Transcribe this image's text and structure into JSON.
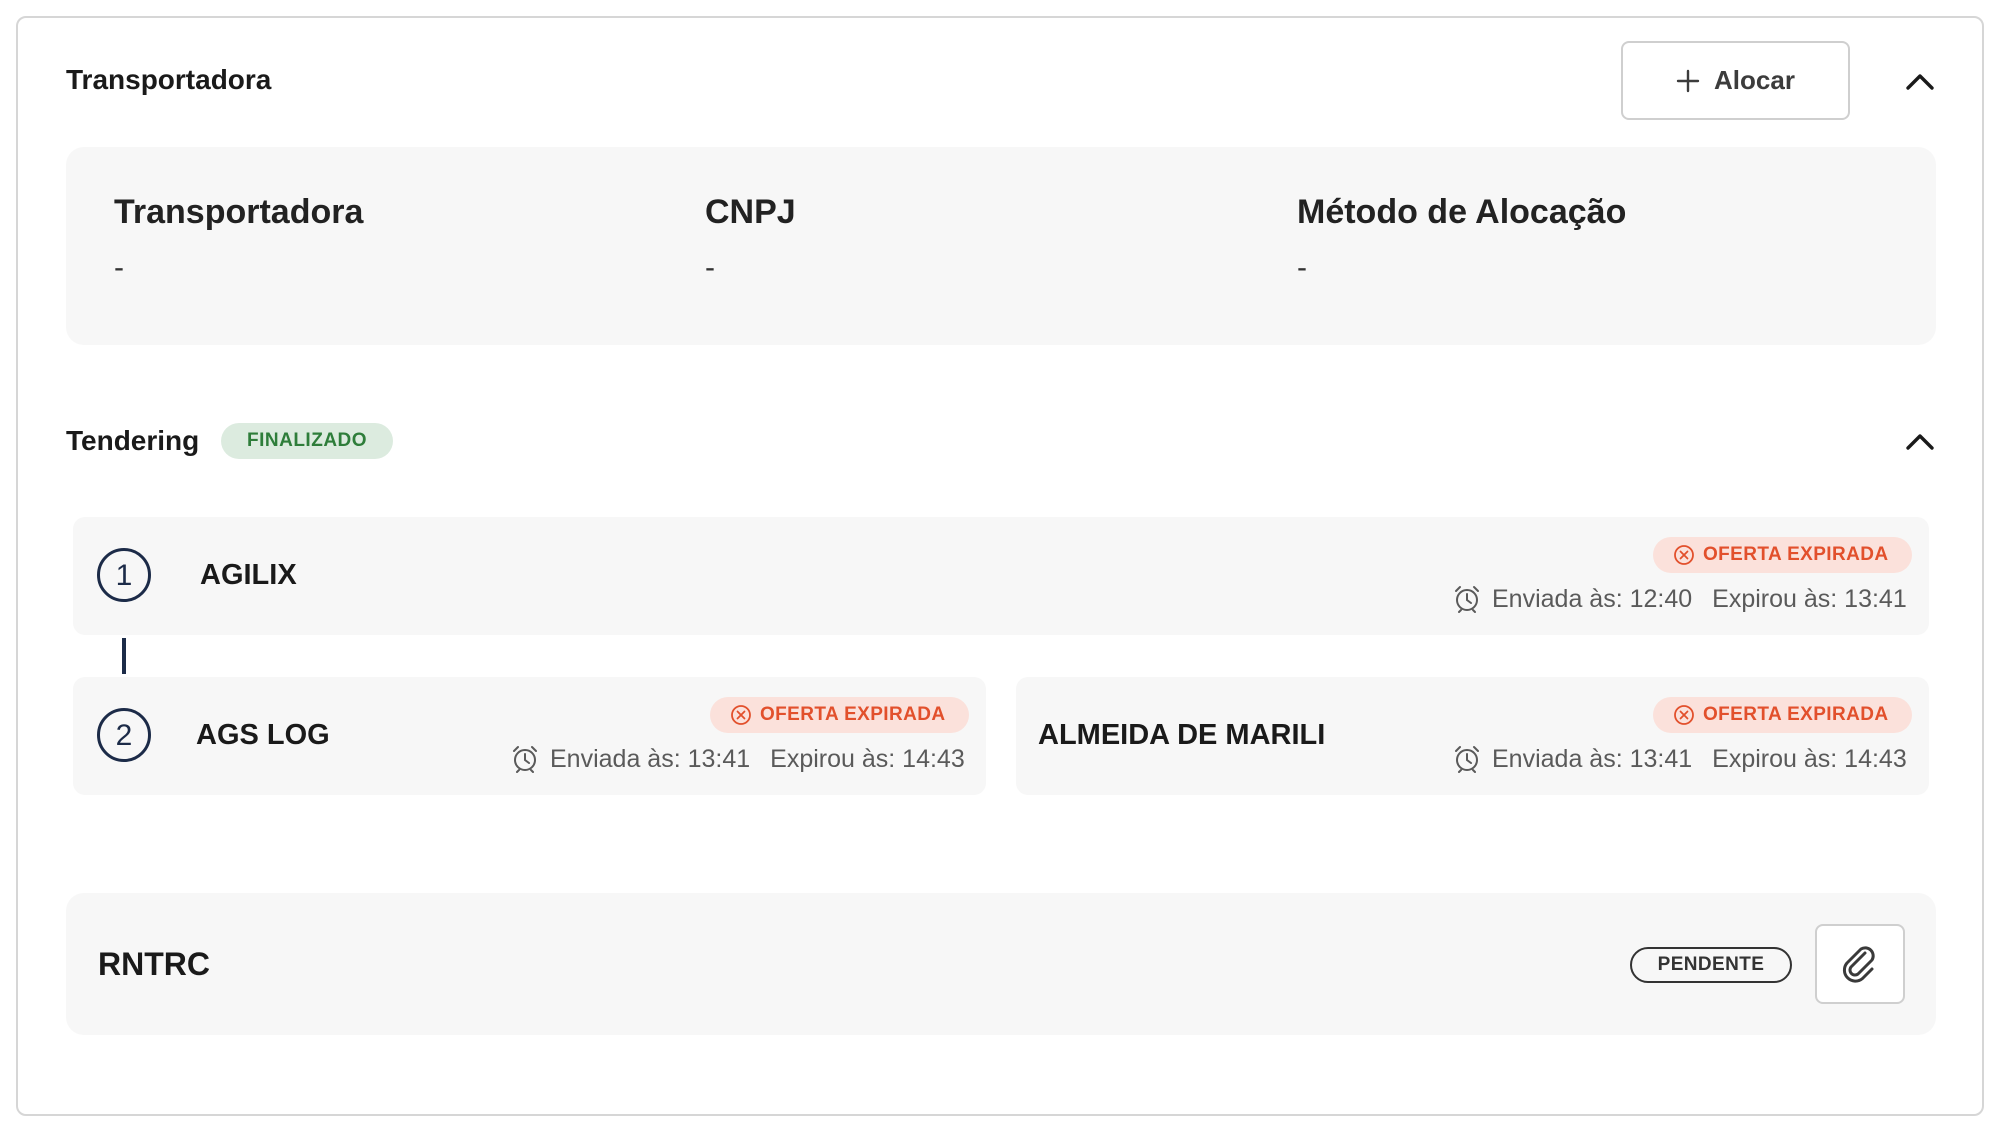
{
  "carrier_section": {
    "title": "Transportadora",
    "allocate_label": "Alocar",
    "fields": [
      {
        "label": "Transportadora",
        "value": "-"
      },
      {
        "label": "CNPJ",
        "value": "-"
      },
      {
        "label": "Método de Alocação",
        "value": "-"
      }
    ]
  },
  "tendering": {
    "title": "Tendering",
    "status": "FINALIZADO",
    "steps": [
      {
        "number": "1",
        "offers": [
          {
            "carrier": "AGILIX",
            "status": "OFERTA EXPIRADA",
            "sent": "Enviada às: 12:40",
            "expired": "Expirou às: 13:41"
          }
        ]
      },
      {
        "number": "2",
        "offers": [
          {
            "carrier": "AGS LOG",
            "status": "OFERTA EXPIRADA",
            "sent": "Enviada às: 13:41",
            "expired": "Expirou às: 14:43"
          },
          {
            "carrier": "ALMEIDA DE MARILI",
            "status": "OFERTA EXPIRADA",
            "sent": "Enviada às: 13:41",
            "expired": "Expirou às: 14:43"
          }
        ]
      }
    ]
  },
  "rntrc": {
    "title": "RNTRC",
    "status": "PENDENTE"
  },
  "colors": {
    "expired_text": "#e2502c",
    "expired_bg": "#fbe1db",
    "finalized_text": "#2e7d3a",
    "finalized_bg": "#dcebdf",
    "step_circle": "#1c2b48"
  },
  "icons": {
    "allocate": "plus-icon",
    "collapse": "chevron-up-icon",
    "expired": "x-circle-icon",
    "time": "alarm-clock-icon",
    "attach": "paperclip-icon"
  }
}
